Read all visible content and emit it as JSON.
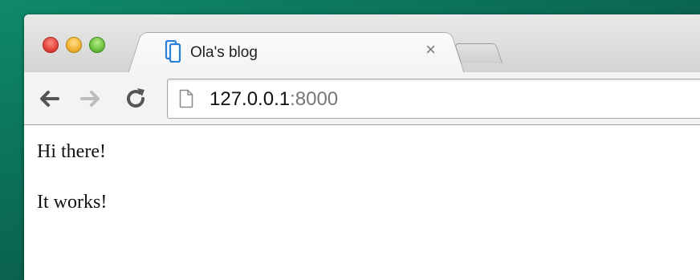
{
  "browser": {
    "tab": {
      "title": "Ola's blog",
      "close_glyph": "×",
      "favicon": "tablet-icon"
    },
    "address_bar": {
      "host": "127.0.0.1",
      "port": ":8000",
      "page_icon": "page-icon"
    },
    "controls": {
      "back": "back-arrow-icon",
      "forward": "forward-arrow-icon",
      "reload": "reload-icon"
    }
  },
  "page": {
    "paragraphs": [
      "Hi there!",
      "It works!"
    ]
  },
  "colors": {
    "desktop": "#0b6f58",
    "favicon": "#2a7fd6"
  }
}
